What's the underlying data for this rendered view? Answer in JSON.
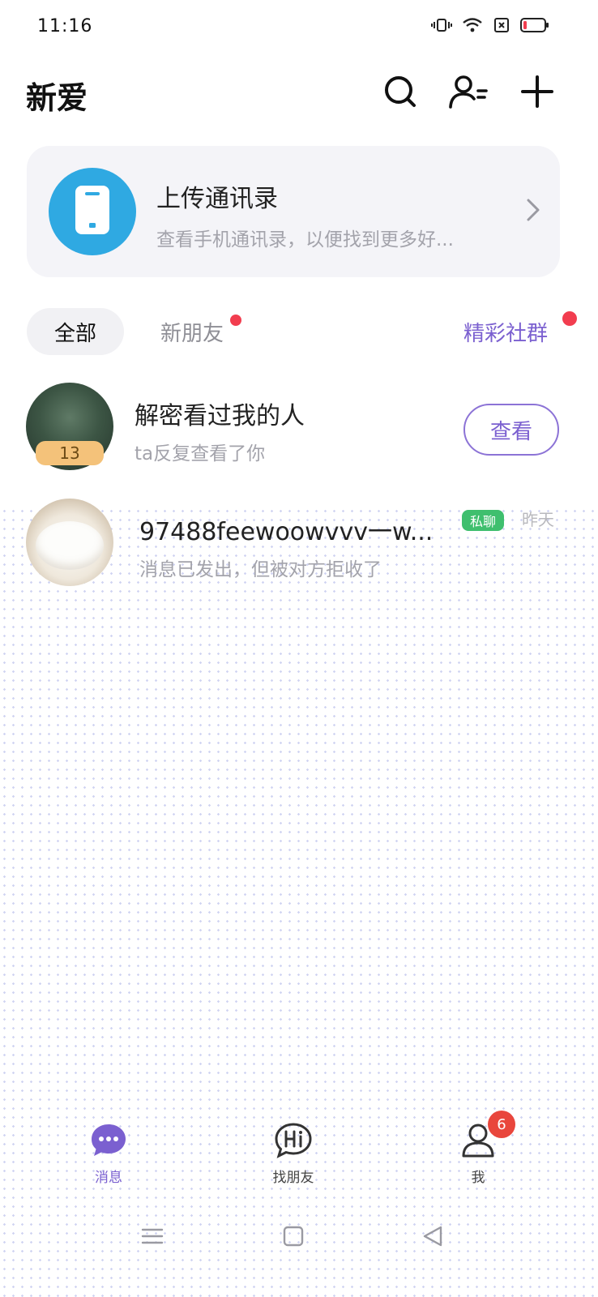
{
  "status_bar": {
    "time": "11:16"
  },
  "header": {
    "title": "新爱"
  },
  "upload_card": {
    "title": "上传通讯录",
    "subtitle": "查看手机通讯录，以便找到更多好..."
  },
  "tabs": {
    "all": "全部",
    "new_friends": "新朋友",
    "community": "精彩社群"
  },
  "rows": [
    {
      "title": "解密看过我的人",
      "subtitle": "ta反复查看了你",
      "badge": "13",
      "button": "查看"
    },
    {
      "title": "97488feewoowvvv一w...",
      "subtitle": "消息已发出，但被对方拒收了",
      "tag": "私聊",
      "time": "昨天"
    }
  ],
  "bottom_nav": {
    "messages": "消息",
    "find_friends": "找朋友",
    "me": "我",
    "me_badge": "6"
  },
  "colors": {
    "accent": "#7b60d0",
    "upload_icon_bg": "#2fa9e2",
    "unread_dot": "#f23d4f",
    "private_tag": "#3fbf6e",
    "nav_badge": "#e9463c"
  },
  "icons": [
    "search-icon",
    "add-friend-icon",
    "plus-icon",
    "phone-icon",
    "chevron-right-icon",
    "chat-bubble-icon",
    "hi-bubble-icon",
    "person-icon",
    "menu-icon",
    "home-square-icon",
    "back-triangle-icon"
  ]
}
